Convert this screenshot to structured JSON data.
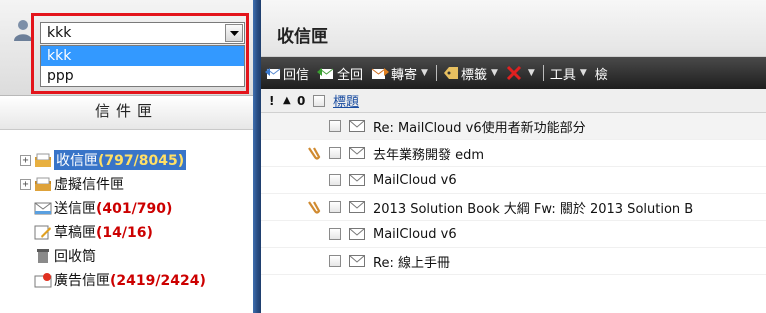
{
  "account": {
    "selected": "kkk",
    "options": [
      "kkk",
      "ppp"
    ]
  },
  "left": {
    "header": "信件匣",
    "folders": [
      {
        "label": "收信匣",
        "count": "(797/8045)",
        "expand": "⊞",
        "selected": true
      },
      {
        "label": "虛擬信件匣",
        "count": "",
        "expand": "⊞",
        "selected": false
      },
      {
        "label": "送信匣",
        "count": "(401/790)",
        "expand": "",
        "selected": false
      },
      {
        "label": "草稿匣",
        "count": "(14/16)",
        "expand": "",
        "selected": false
      },
      {
        "label": "回收筒",
        "count": "",
        "expand": "",
        "selected": false
      },
      {
        "label": "廣告信匣",
        "count": "(2419/2424)",
        "expand": "",
        "selected": false
      }
    ]
  },
  "main": {
    "title": "收信匣",
    "toolbar": {
      "reply": "回信",
      "reply_all": "全回",
      "forward": "轉寄",
      "tag": "標籤",
      "tools": "工具",
      "search": "檢"
    },
    "columns": {
      "flag": "!",
      "priority": "▲",
      "attach": "0",
      "subject": "標題"
    },
    "mails": [
      {
        "subject": "Re: MailCloud v6使用者新功能部分",
        "attachment": false
      },
      {
        "subject": "去年業務開發 edm",
        "attachment": true
      },
      {
        "subject": "MailCloud v6",
        "attachment": false
      },
      {
        "subject": "2013 Solution Book 大綱 Fw: 關於 2013 Solution B",
        "attachment": true
      },
      {
        "subject": "MailCloud v6",
        "attachment": false
      },
      {
        "subject": "Re: 線上手冊",
        "attachment": false
      }
    ]
  },
  "colors": {
    "highlight": "#e3141b",
    "selected_option": "#3399ff",
    "count_red": "#c00000",
    "splitter": "#2a4f86"
  }
}
